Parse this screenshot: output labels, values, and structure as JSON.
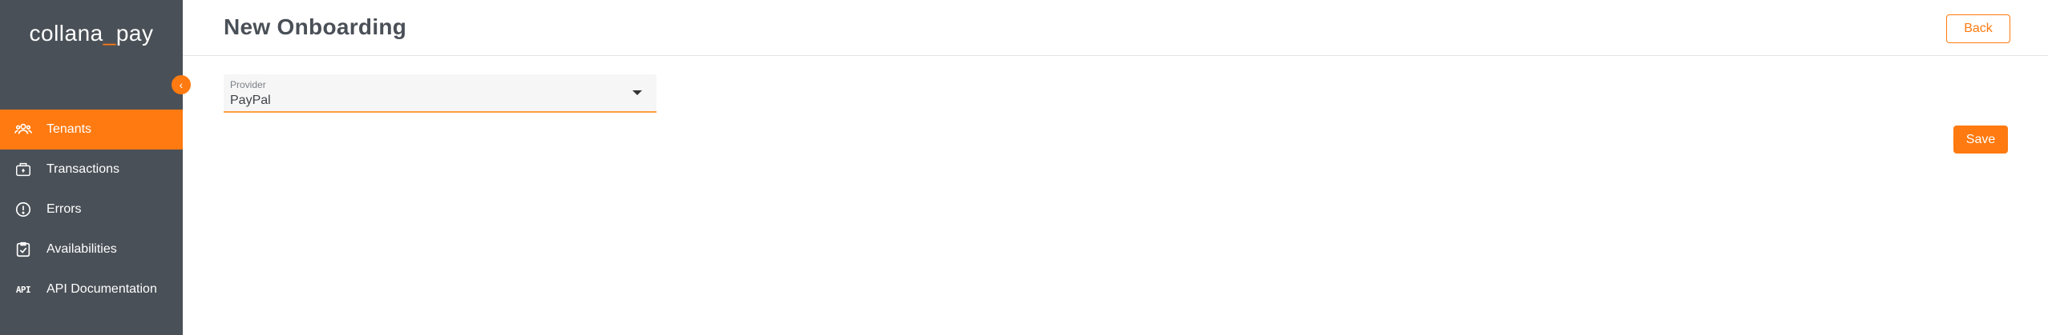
{
  "app": {
    "logo_main": "collana",
    "logo_sep": "_",
    "logo_sub": "pay"
  },
  "sidebar": {
    "items": [
      {
        "label": "Tenants",
        "icon": "tenants-icon",
        "active": true
      },
      {
        "label": "Transactions",
        "icon": "transactions-icon",
        "active": false
      },
      {
        "label": "Errors",
        "icon": "error-icon",
        "active": false
      },
      {
        "label": "Availabilities",
        "icon": "availabilities-icon",
        "active": false
      },
      {
        "label": "API Documentation",
        "icon": "api-icon",
        "active": false
      }
    ],
    "api_icon_text": "API"
  },
  "header": {
    "title": "New Onboarding",
    "back_label": "Back"
  },
  "form": {
    "provider_label": "Provider",
    "provider_value": "PayPal",
    "save_label": "Save"
  },
  "colors": {
    "accent": "#ff7a10",
    "sidebar_bg": "#4a5057"
  }
}
